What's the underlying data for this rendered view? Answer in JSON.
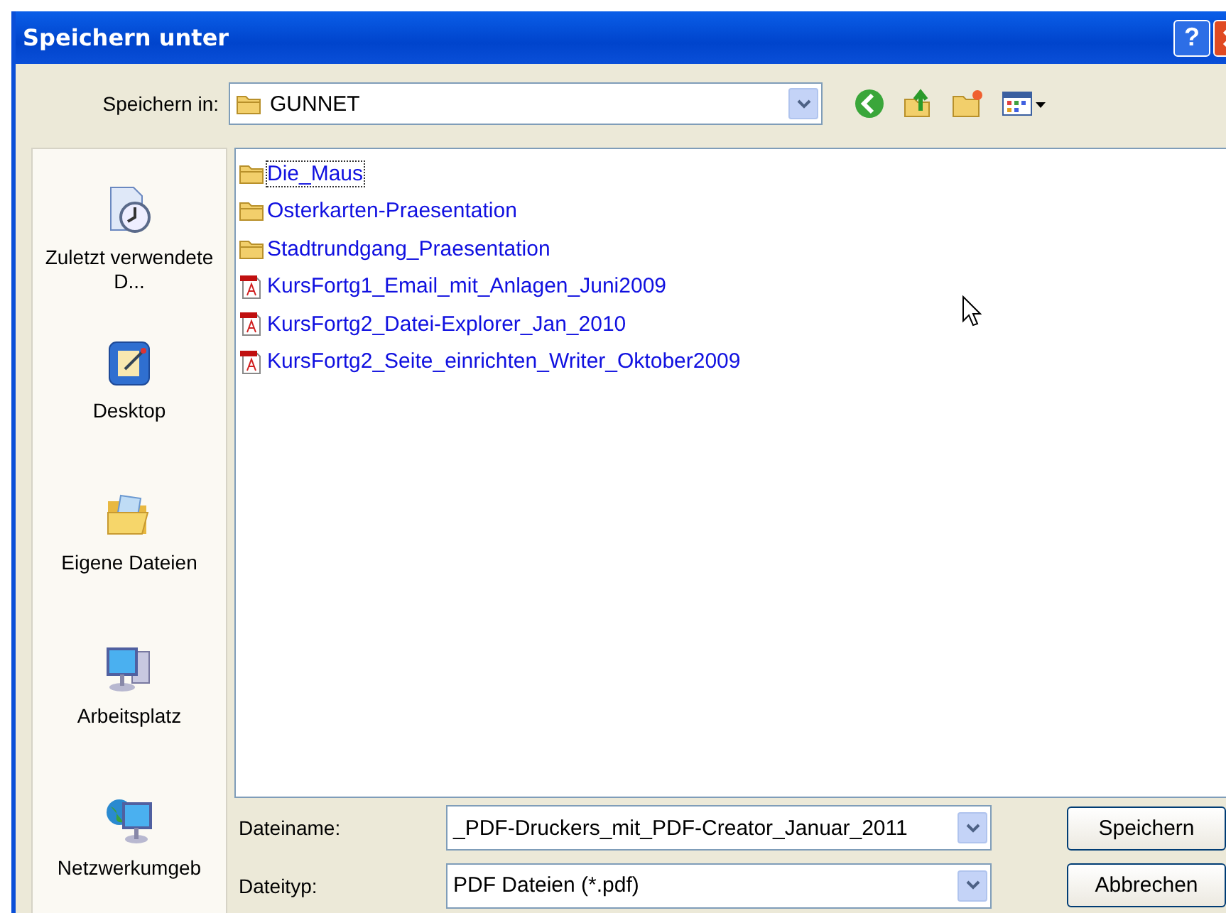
{
  "window": {
    "title": "Speichern unter",
    "help_button": "?"
  },
  "location": {
    "label": "Speichern in:",
    "value": "GUNNET"
  },
  "places": [
    {
      "label": "Zuletzt verwendete D...",
      "kind": "recent"
    },
    {
      "label": "Desktop",
      "kind": "desktop"
    },
    {
      "label": "Eigene Dateien",
      "kind": "documents"
    },
    {
      "label": "Arbeitsplatz",
      "kind": "computer"
    },
    {
      "label": "Netzwerkumgeb",
      "kind": "network"
    }
  ],
  "files": [
    {
      "name": "Die_Maus",
      "kind": "folder",
      "focused": true
    },
    {
      "name": "Osterkarten-Praesentation",
      "kind": "folder",
      "focused": false
    },
    {
      "name": "Stadtrundgang_Praesentation",
      "kind": "folder",
      "focused": false
    },
    {
      "name": "KursFortg1_Email_mit_Anlagen_Juni2009",
      "kind": "pdf",
      "focused": false
    },
    {
      "name": "KursFortg2_Datei-Explorer_Jan_2010",
      "kind": "pdf",
      "focused": false
    },
    {
      "name": "KursFortg2_Seite_einrichten_Writer_Oktober2009",
      "kind": "pdf",
      "focused": false
    }
  ],
  "filename": {
    "label": "Dateiname:",
    "value": "_PDF-Druckers_mit_PDF-Creator_Januar_2011"
  },
  "filetype": {
    "label": "Dateityp:",
    "value": "PDF Dateien (*.pdf)"
  },
  "buttons": [
    "Speichern",
    "Abbrechen"
  ]
}
